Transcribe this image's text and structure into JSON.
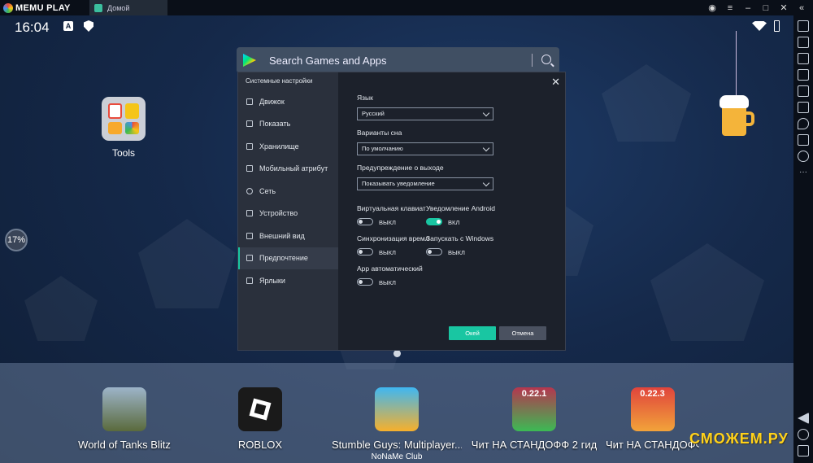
{
  "titlebar": {
    "app_name": "MEMU PLAY",
    "tab_label": "Домой"
  },
  "statusbar": {
    "clock": "16:04",
    "badge_a": "A"
  },
  "search": {
    "placeholder": "Search Games and Apps"
  },
  "desktop": {
    "tools_label": "Tools",
    "progress_percent": "17%"
  },
  "dock": {
    "apps": [
      {
        "label": "World of Tanks Blitz"
      },
      {
        "label": "ROBLOX"
      },
      {
        "label": "Stumble Guys: Multiplayer...",
        "sub": "NoNaMe Club"
      },
      {
        "label": "Чит НА СТАНДОФФ 2 гид",
        "badge": "0.22.1"
      },
      {
        "label": "Чит НА СТАНДОФФ",
        "badge": "0.22.3"
      }
    ]
  },
  "dialog": {
    "title": "Системные настройки",
    "nav": [
      "Движок",
      "Показать",
      "Хранилище",
      "Мобильный атрибут",
      "Сеть",
      "Устройство",
      "Внешний вид",
      "Предпочтение",
      "Ярлыки"
    ],
    "active_nav": "Предпочтение",
    "fields": {
      "language_label": "Язык",
      "language_value": "Русский",
      "sleep_label": "Варианты сна",
      "sleep_value": "По умолчанию",
      "exit_label": "Предупреждение о выходе",
      "exit_value": "Показывать уведомление",
      "vkbd_label": "Виртуальная клавиат",
      "vkbd_state": "ВЫКЛ",
      "android_notif_label": "Уведомление Android",
      "android_notif_state": "ВКЛ",
      "sync_time_label": "Синхронизация времл",
      "sync_time_state": "ВЫКЛ",
      "autostart_label": "Запускать с Windows",
      "autostart_state": "ВЫКЛ",
      "app_auto_label": "App автоматический",
      "app_auto_state": "ВЫКЛ"
    },
    "ok_label": "Окей",
    "cancel_label": "Отмена"
  },
  "watermark": "СМОЖЕМ.РУ",
  "colors": {
    "accent": "#19c6a2",
    "dialog_bg": "#1c212b",
    "sidebar_bg": "#2a303c"
  }
}
